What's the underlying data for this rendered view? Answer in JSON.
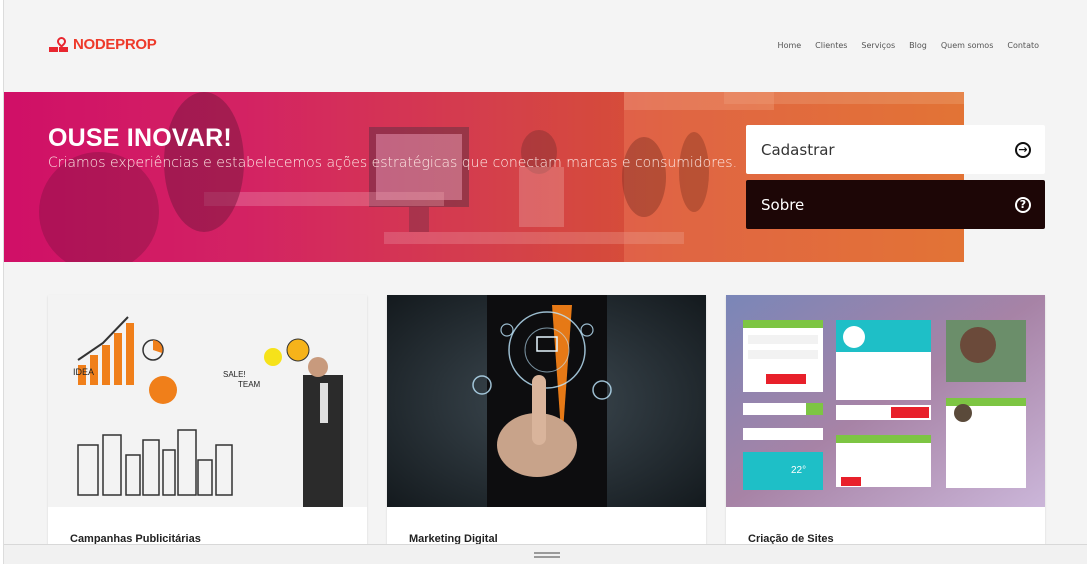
{
  "brand": {
    "name": "NODEPROP",
    "color": "#ee3a2a"
  },
  "nav": {
    "items": [
      "Home",
      "Clientes",
      "Serviços",
      "Blog",
      "Quem somos",
      "Contato"
    ]
  },
  "hero": {
    "title": "OUSE INOVAR!",
    "subtitle": "Criamos experiências e estabelecemos ações estratégicas que conectam marcas e consumidores."
  },
  "cta": {
    "register_label": "Cadastrar",
    "register_icon": "arrow-right-circle-icon",
    "about_label": "Sobre",
    "about_icon": "question-circle-icon"
  },
  "cards": [
    {
      "title": "Campanhas Publicitárias"
    },
    {
      "title": "Marketing Digital"
    },
    {
      "title": "Criação de Sites"
    }
  ],
  "colors": {
    "hero_start": "#e30e6e",
    "hero_end": "#ed6e1f",
    "about_bg": "#1d0606"
  }
}
